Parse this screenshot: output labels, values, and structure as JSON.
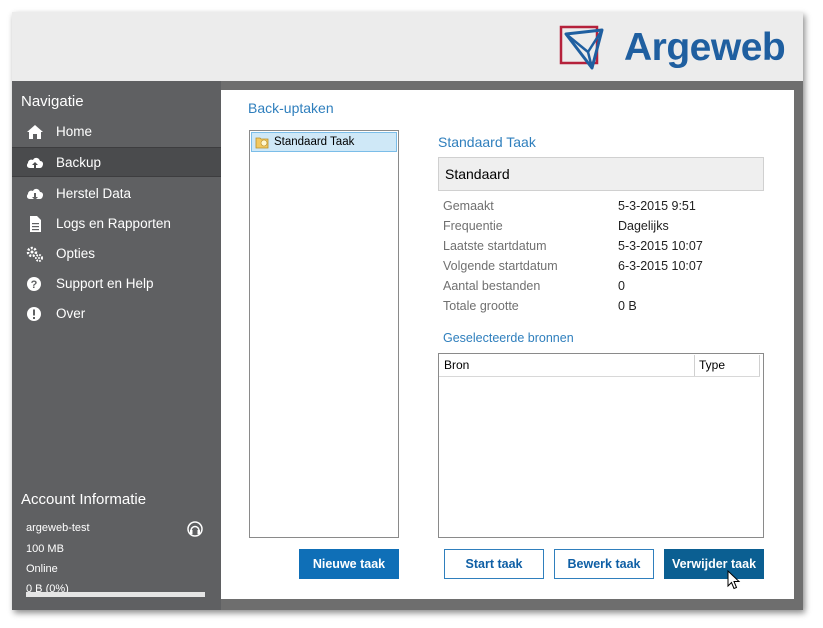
{
  "brand": {
    "name": "Argeweb",
    "color": "#1f5fa0",
    "accent": "#b5213b"
  },
  "sidebar": {
    "title": "Navigatie",
    "items": [
      {
        "label": "Home",
        "icon": "home-icon",
        "active": false
      },
      {
        "label": "Backup",
        "icon": "cloud-upload-icon",
        "active": true
      },
      {
        "label": "Herstel Data",
        "icon": "cloud-download-icon",
        "active": false
      },
      {
        "label": "Logs en Rapporten",
        "icon": "document-icon",
        "active": false
      },
      {
        "label": "Opties",
        "icon": "gears-icon",
        "active": false
      },
      {
        "label": "Support en Help",
        "icon": "help-icon",
        "active": false
      },
      {
        "label": "Over",
        "icon": "info-exclamation-icon",
        "active": false
      }
    ]
  },
  "account": {
    "title": "Account Informatie",
    "username": "argeweb-test",
    "quota": "100 MB",
    "status": "Online",
    "usage": "0 B (0%)",
    "usage_fraction": 0
  },
  "main": {
    "title": "Back-uptaken",
    "tasks": [
      {
        "label": "Standaard Taak",
        "icon": "backup-folder-icon"
      }
    ],
    "new_task_label": "Nieuwe taak",
    "detail": {
      "title": "Standaard Taak",
      "name": "Standaard",
      "properties": [
        {
          "label": "Gemaakt",
          "value": "5-3-2015 9:51"
        },
        {
          "label": "Frequentie",
          "value": "Dagelijks"
        },
        {
          "label": "Laatste startdatum",
          "value": "5-3-2015 10:07"
        },
        {
          "label": "Volgende startdatum",
          "value": "6-3-2015 10:07"
        },
        {
          "label": "Aantal bestanden",
          "value": "0"
        },
        {
          "label": "Totale grootte",
          "value": "0 B"
        }
      ],
      "sources_title": "Geselecteerde bronnen",
      "sources_columns": [
        "Bron",
        "Type"
      ]
    },
    "buttons": {
      "start": "Start taak",
      "edit": "Bewerk taak",
      "delete": "Verwijder taak"
    }
  }
}
